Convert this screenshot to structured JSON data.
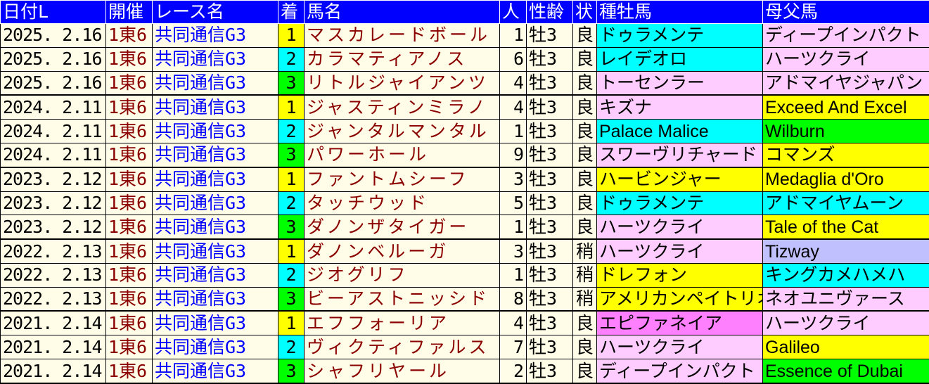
{
  "headers": [
    "日付L",
    "開催",
    "レース名",
    "着",
    "馬名",
    "人",
    "性齢",
    "状",
    "種牡馬",
    "母父馬"
  ],
  "colors": {
    "header_bg": "#0000ff",
    "row_bg": "#fffde7",
    "yellow": "#ffff00",
    "cyan": "#00ffff",
    "green": "#00ff00",
    "pink": "#ffccff",
    "lavender": "#c0c0ff",
    "magenta": "#ff80ff",
    "venue_text": "#8b0000",
    "race_text": "#0000ff"
  },
  "rows": [
    {
      "date": "2025. 2.16",
      "venue": "1東6",
      "race": "共同通信G3",
      "rank": "1",
      "rank_color": "yellow",
      "horse": "マスカレードボール",
      "pop": "1",
      "sexage": "牡3",
      "cond": "良",
      "sire": "ドゥラメンテ",
      "sire_color": "cyan",
      "bms": "ディープインパクト",
      "bms_color": "pink"
    },
    {
      "date": "2025. 2.16",
      "venue": "1東6",
      "race": "共同通信G3",
      "rank": "2",
      "rank_color": "cyan",
      "horse": "カラマティアノス",
      "pop": "6",
      "sexage": "牡3",
      "cond": "良",
      "sire": "レイデオロ",
      "sire_color": "cyan",
      "bms": "ハーツクライ",
      "bms_color": "pink"
    },
    {
      "date": "2025. 2.16",
      "venue": "1東6",
      "race": "共同通信G3",
      "rank": "3",
      "rank_color": "green",
      "horse": "リトルジャイアンツ",
      "pop": "4",
      "sexage": "牡3",
      "cond": "良",
      "sire": "トーセンラー",
      "sire_color": "pink",
      "bms": "アドマイヤジャパン",
      "bms_color": "pink"
    },
    {
      "date": "2024. 2.11",
      "venue": "1東6",
      "race": "共同通信G3",
      "rank": "1",
      "rank_color": "yellow",
      "horse": "ジャスティンミラノ",
      "pop": "4",
      "sexage": "牡3",
      "cond": "良",
      "sire": "キズナ",
      "sire_color": "pink",
      "bms": "Exceed And Excel",
      "bms_color": "yellow"
    },
    {
      "date": "2024. 2.11",
      "venue": "1東6",
      "race": "共同通信G3",
      "rank": "2",
      "rank_color": "cyan",
      "horse": "ジャンタルマンタル",
      "pop": "1",
      "sexage": "牡3",
      "cond": "良",
      "sire": "Palace Malice",
      "sire_color": "cyan",
      "bms": "Wilburn",
      "bms_color": "green"
    },
    {
      "date": "2024. 2.11",
      "venue": "1東6",
      "race": "共同通信G3",
      "rank": "3",
      "rank_color": "green",
      "horse": "パワーホール",
      "pop": "9",
      "sexage": "牡3",
      "cond": "良",
      "sire": "スワーヴリチャード",
      "sire_color": "pink",
      "bms": "コマンズ",
      "bms_color": "yellow"
    },
    {
      "date": "2023. 2.12",
      "venue": "1東6",
      "race": "共同通信G3",
      "rank": "1",
      "rank_color": "yellow",
      "horse": "ファントムシーフ",
      "pop": "3",
      "sexage": "牡3",
      "cond": "良",
      "sire": "ハービンジャー",
      "sire_color": "yellow",
      "bms": "Medaglia d'Oro",
      "bms_color": "yellow"
    },
    {
      "date": "2023. 2.12",
      "venue": "1東6",
      "race": "共同通信G3",
      "rank": "2",
      "rank_color": "cyan",
      "horse": "タッチウッド",
      "pop": "5",
      "sexage": "牡3",
      "cond": "良",
      "sire": "ドゥラメンテ",
      "sire_color": "cyan",
      "bms": "アドマイヤムーン",
      "bms_color": "cyan"
    },
    {
      "date": "2023. 2.12",
      "venue": "1東6",
      "race": "共同通信G3",
      "rank": "3",
      "rank_color": "green",
      "horse": "ダノンザタイガー",
      "pop": "1",
      "sexage": "牡3",
      "cond": "良",
      "sire": "ハーツクライ",
      "sire_color": "pink",
      "bms": "Tale of the Cat",
      "bms_color": "yellow"
    },
    {
      "date": "2022. 2.13",
      "venue": "1東6",
      "race": "共同通信G3",
      "rank": "1",
      "rank_color": "yellow",
      "horse": "ダノンベルーガ",
      "pop": "3",
      "sexage": "牡3",
      "cond": "稍",
      "sire": "ハーツクライ",
      "sire_color": "pink",
      "bms": "Tizway",
      "bms_color": "lavender"
    },
    {
      "date": "2022. 2.13",
      "venue": "1東6",
      "race": "共同通信G3",
      "rank": "2",
      "rank_color": "cyan",
      "horse": "ジオグリフ",
      "pop": "1",
      "sexage": "牡3",
      "cond": "稍",
      "sire": "ドレフォン",
      "sire_color": "yellow",
      "bms": "キングカメハメハ",
      "bms_color": "cyan"
    },
    {
      "date": "2022. 2.13",
      "venue": "1東6",
      "race": "共同通信G3",
      "rank": "3",
      "rank_color": "green",
      "horse": "ビーアストニッシド",
      "pop": "8",
      "sexage": "牡3",
      "cond": "稍",
      "sire": "アメリカンペイトリオット",
      "sire_color": "yellow",
      "bms": "ネオユニヴァース",
      "bms_color": "pink"
    },
    {
      "date": "2021. 2.14",
      "venue": "1東6",
      "race": "共同通信G3",
      "rank": "1",
      "rank_color": "yellow",
      "horse": "エフフォーリア",
      "pop": "4",
      "sexage": "牡3",
      "cond": "良",
      "sire": "エピファネイア",
      "sire_color": "magenta",
      "bms": "ハーツクライ",
      "bms_color": "pink"
    },
    {
      "date": "2021. 2.14",
      "venue": "1東6",
      "race": "共同通信G3",
      "rank": "2",
      "rank_color": "cyan",
      "horse": "ヴィクティファルス",
      "pop": "7",
      "sexage": "牡3",
      "cond": "良",
      "sire": "ハーツクライ",
      "sire_color": "pink",
      "bms": "Galileo",
      "bms_color": "yellow"
    },
    {
      "date": "2021. 2.14",
      "venue": "1東6",
      "race": "共同通信G3",
      "rank": "3",
      "rank_color": "green",
      "horse": "シャフリヤール",
      "pop": "2",
      "sexage": "牡3",
      "cond": "良",
      "sire": "ディープインパクト",
      "sire_color": "pink",
      "bms": "Essence of Dubai",
      "bms_color": "green"
    }
  ]
}
